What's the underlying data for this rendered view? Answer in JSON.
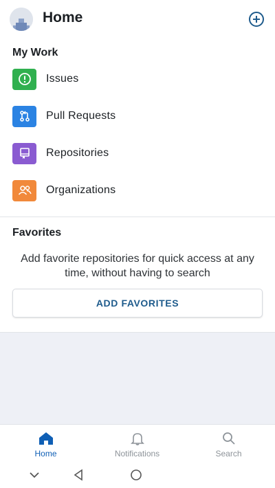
{
  "header": {
    "title": "Home",
    "avatar_icon": "avatar-icon",
    "add_icon": "plus-circle-icon"
  },
  "my_work": {
    "title": "My Work",
    "items": [
      {
        "label": "Issues",
        "icon": "issue-icon",
        "color": "#30b04f"
      },
      {
        "label": "Pull Requests",
        "icon": "pull-request-icon",
        "color": "#2b83e3"
      },
      {
        "label": "Repositories",
        "icon": "repo-icon",
        "color": "#8a5bd1"
      },
      {
        "label": "Organizations",
        "icon": "organization-icon",
        "color": "#f1893b"
      }
    ]
  },
  "favorites": {
    "title": "Favorites",
    "description": "Add favorite repositories for quick access at any time, without having to search",
    "button_label": "ADD FAVORITES"
  },
  "tabbar": {
    "tabs": [
      {
        "label": "Home",
        "icon": "home-icon",
        "active": true
      },
      {
        "label": "Notifications",
        "icon": "bell-icon",
        "active": false
      },
      {
        "label": "Search",
        "icon": "search-icon",
        "active": false
      }
    ]
  },
  "colors": {
    "accent": "#1e5b8c",
    "active_tab": "#0f5fb5",
    "inactive_tab": "#8d9399"
  }
}
